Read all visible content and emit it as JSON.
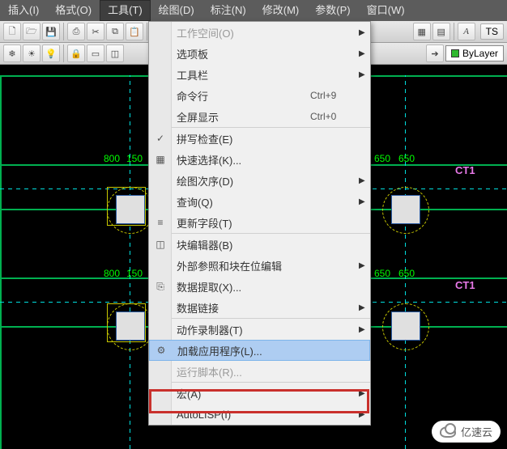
{
  "menubar": {
    "items": [
      {
        "label": "插入(I)"
      },
      {
        "label": "格式(O)"
      },
      {
        "label": "工具(T)",
        "active": true
      },
      {
        "label": "绘图(D)"
      },
      {
        "label": "标注(N)"
      },
      {
        "label": "修改(M)"
      },
      {
        "label": "参数(P)"
      },
      {
        "label": "窗口(W)"
      }
    ]
  },
  "toolbar2": {
    "bylayer": "ByLayer",
    "ts": "TS"
  },
  "dropdown": {
    "items": [
      {
        "label": "工作空间(O)",
        "sub": true,
        "dim": true
      },
      {
        "label": "选项板",
        "sub": true
      },
      {
        "label": "工具栏",
        "sub": true
      },
      {
        "label": "命令行",
        "shortcut": "Ctrl+9"
      },
      {
        "label": "全屏显示",
        "shortcut": "Ctrl+0"
      },
      {
        "sep": true
      },
      {
        "label": "拼写检查(E)",
        "icon": "✓"
      },
      {
        "label": "快速选择(K)...",
        "icon": "▦"
      },
      {
        "label": "绘图次序(D)",
        "sub": true
      },
      {
        "label": "查询(Q)",
        "sub": true
      },
      {
        "label": "更新字段(T)",
        "icon": "≡"
      },
      {
        "sep": true
      },
      {
        "label": "块编辑器(B)",
        "icon": "◫"
      },
      {
        "label": "外部参照和块在位编辑",
        "sub": true
      },
      {
        "label": "数据提取(X)...",
        "icon": "⎘"
      },
      {
        "label": "数据链接",
        "sub": true
      },
      {
        "sep": true
      },
      {
        "label": "动作录制器(T)",
        "sub": true
      },
      {
        "label": "加载应用程序(L)...",
        "icon": "⚙",
        "selected": true
      },
      {
        "label": "运行脚本(R)...",
        "dim": true
      },
      {
        "sep": true
      },
      {
        "label": "宏(A)",
        "sub": true
      },
      {
        "label": "AutoLISP(I)",
        "sub": true
      }
    ]
  },
  "dims": {
    "a": "800",
    "b": "150",
    "c": "650",
    "d": "650"
  },
  "ct1": "CT1",
  "watermark": "亿速云"
}
